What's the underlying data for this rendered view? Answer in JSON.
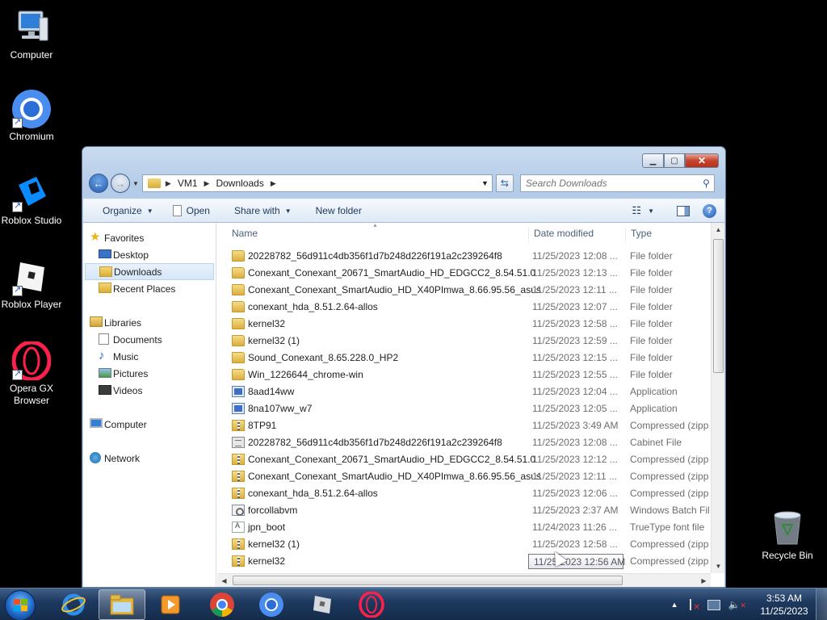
{
  "desktop": {
    "icons": [
      {
        "label": "Computer"
      },
      {
        "label": "Chromium"
      },
      {
        "label": "Roblox Studio"
      },
      {
        "label": "Roblox Player"
      },
      {
        "label": "Opera GX Browser"
      },
      {
        "label": "Recycle Bin"
      }
    ]
  },
  "window": {
    "address": {
      "root": "VM1",
      "folder": "Downloads"
    },
    "search_placeholder": "Search Downloads",
    "toolbar": {
      "organize": "Organize",
      "open": "Open",
      "share": "Share with",
      "new_folder": "New folder"
    },
    "nav": {
      "favorites": "Favorites",
      "desktop": "Desktop",
      "downloads": "Downloads",
      "recent": "Recent Places",
      "libraries": "Libraries",
      "documents": "Documents",
      "music": "Music",
      "pictures": "Pictures",
      "videos": "Videos",
      "computer": "Computer",
      "network": "Network"
    },
    "columns": {
      "name": "Name",
      "date": "Date modified",
      "type": "Type"
    },
    "files": [
      {
        "name": "20228782_56d911c4db356f1d7b248d226f191a2c239264f8",
        "date": "11/25/2023 12:08 ...",
        "type": "File folder",
        "icon": "folder"
      },
      {
        "name": "Conexant_Conexant_20671_SmartAudio_HD_EDGCC2_8.54.51.0",
        "date": "11/25/2023 12:13 ...",
        "type": "File folder",
        "icon": "folder"
      },
      {
        "name": "Conexant_Conexant_SmartAudio_HD_X40PImwa_8.66.95.56_asus",
        "date": "11/25/2023 12:11 ...",
        "type": "File folder",
        "icon": "folder"
      },
      {
        "name": "conexant_hda_8.51.2.64-allos",
        "date": "11/25/2023 12:07 ...",
        "type": "File folder",
        "icon": "folder"
      },
      {
        "name": "kernel32",
        "date": "11/25/2023 12:58 ...",
        "type": "File folder",
        "icon": "folder"
      },
      {
        "name": "kernel32 (1)",
        "date": "11/25/2023 12:59 ...",
        "type": "File folder",
        "icon": "folder"
      },
      {
        "name": "Sound_Conexant_8.65.228.0_HP2",
        "date": "11/25/2023 12:15 ...",
        "type": "File folder",
        "icon": "folder"
      },
      {
        "name": "Win_1226644_chrome-win",
        "date": "11/25/2023 12:55 ...",
        "type": "File folder",
        "icon": "folder"
      },
      {
        "name": "8aad14ww",
        "date": "11/25/2023 12:04 ...",
        "type": "Application",
        "icon": "app"
      },
      {
        "name": "8na107ww_w7",
        "date": "11/25/2023 12:05 ...",
        "type": "Application",
        "icon": "app"
      },
      {
        "name": "8TP91",
        "date": "11/25/2023 3:49 AM",
        "type": "Compressed (zipp",
        "icon": "zip"
      },
      {
        "name": "20228782_56d911c4db356f1d7b248d226f191a2c239264f8",
        "date": "11/25/2023 12:08 ...",
        "type": "Cabinet File",
        "icon": "cab"
      },
      {
        "name": "Conexant_Conexant_20671_SmartAudio_HD_EDGCC2_8.54.51.0",
        "date": "11/25/2023 12:12 ...",
        "type": "Compressed (zipp",
        "icon": "zip"
      },
      {
        "name": "Conexant_Conexant_SmartAudio_HD_X40PImwa_8.66.95.56_asus",
        "date": "11/25/2023 12:11 ...",
        "type": "Compressed (zipp",
        "icon": "zip"
      },
      {
        "name": "conexant_hda_8.51.2.64-allos",
        "date": "11/25/2023 12:06 ...",
        "type": "Compressed (zipp",
        "icon": "zip"
      },
      {
        "name": "forcollabvm",
        "date": "11/25/2023 2:37 AM",
        "type": "Windows Batch Fil",
        "icon": "bat"
      },
      {
        "name": "jpn_boot",
        "date": "11/24/2023 11:26 ...",
        "type": "TrueType font file",
        "icon": "font"
      },
      {
        "name": "kernel32 (1)",
        "date": "11/25/2023 12:58 ...",
        "type": "Compressed (zipp",
        "icon": "zip"
      },
      {
        "name": "kernel32",
        "date": "11/25/2023 12:56 ...",
        "type": "Compressed (zipp",
        "icon": "zip"
      }
    ],
    "tooltip": "11/25/2023 12:56 AM"
  },
  "taskbar": {
    "clock_time": "3:53 AM",
    "clock_date": "11/25/2023"
  }
}
